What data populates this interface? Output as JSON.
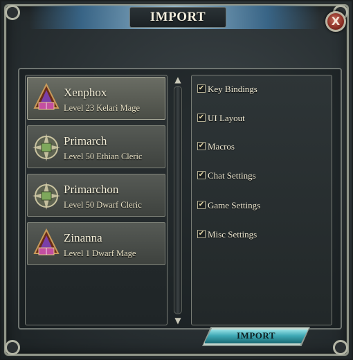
{
  "window": {
    "title": "IMPORT",
    "close_label": "X"
  },
  "characters": [
    {
      "name": "Xenphox",
      "description": "Level 23 Kelari Mage",
      "icon": "mage-icon",
      "selected": true
    },
    {
      "name": "Primarch",
      "description": "Level 50 Ethian Cleric",
      "icon": "cleric-icon",
      "selected": false
    },
    {
      "name": "Primarchon",
      "description": "Level 50 Dwarf Cleric",
      "icon": "cleric-icon",
      "selected": false
    },
    {
      "name": "Zinanna",
      "description": "Level 1 Dwarf Mage",
      "icon": "mage-icon",
      "selected": false
    }
  ],
  "scrollbar": {
    "up_glyph": "▲",
    "down_glyph": "▼"
  },
  "settings": [
    {
      "label": "Key Bindings",
      "checked": true
    },
    {
      "label": "UI Layout",
      "checked": true
    },
    {
      "label": "Macros",
      "checked": true
    },
    {
      "label": "Chat Settings",
      "checked": true
    },
    {
      "label": "Game Settings",
      "checked": true
    },
    {
      "label": "Misc Settings",
      "checked": true
    }
  ],
  "import_button": {
    "label": "IMPORT"
  },
  "check_glyph": "✔",
  "colors": {
    "accent": "#3ea9b5",
    "title_glow": "#9cc3da",
    "close_red": "#8a2f24"
  }
}
